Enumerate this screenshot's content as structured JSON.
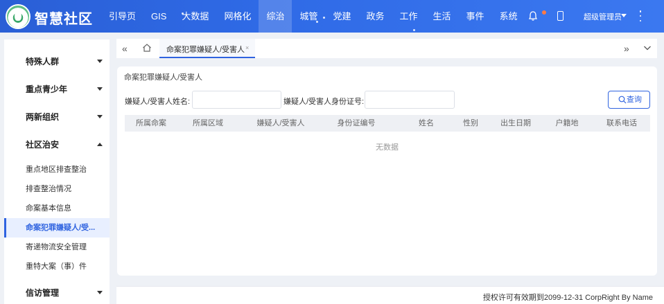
{
  "header": {
    "app_title": "智慧社区",
    "nav": [
      "引导页",
      "GIS",
      "大数据",
      "网格化",
      "综治",
      "城管",
      "党建",
      "政务",
      "工作",
      "生活",
      "事件",
      "系统"
    ],
    "active_nav": "综治",
    "user_name": "超级管理员",
    "icons": [
      "bell-icon",
      "mobile-icon",
      "more-vertical-icon"
    ]
  },
  "sidebar": {
    "groups": [
      {
        "label": "特殊人群",
        "expanded": false
      },
      {
        "label": "重点青少年",
        "expanded": false
      },
      {
        "label": "两新组织",
        "expanded": false
      },
      {
        "label": "社区治安",
        "expanded": true
      },
      {
        "label": "信访管理",
        "expanded": false
      }
    ],
    "items": [
      "重点地区排查整治",
      "排查整治情况",
      "命案基本信息",
      "命案犯罪嫌疑人/受...",
      "寄递物流安全管理",
      "重特大案（事）件"
    ],
    "active_item": "命案犯罪嫌疑人/受..."
  },
  "tabbar": {
    "tabs": [
      {
        "label": "命案犯罪嫌疑人/受害人",
        "close": "×"
      }
    ]
  },
  "main": {
    "panel_title": "命案犯罪嫌疑人/受害人",
    "search": {
      "name_label": "嫌疑人/受害人姓名:",
      "name_value": "",
      "id_label": "嫌疑人/受害人身份证号:",
      "id_value": "",
      "query_button": "查询"
    },
    "table": {
      "columns": [
        "所属命案",
        "所属区域",
        "嫌疑人/受害人",
        "身份证编号",
        "姓名",
        "性别",
        "出生日期",
        "户籍地",
        "联系电话"
      ],
      "rows": [],
      "empty_text": "无数据"
    }
  },
  "footer": {
    "text": "授权许可有效期到2099-12-31 CorpRight By Name"
  },
  "colors": {
    "header_bg": "#2f6ae6",
    "accent": "#2f63e0",
    "page_bg": "#eef1f6",
    "notification_dot": "#ff7a45"
  }
}
